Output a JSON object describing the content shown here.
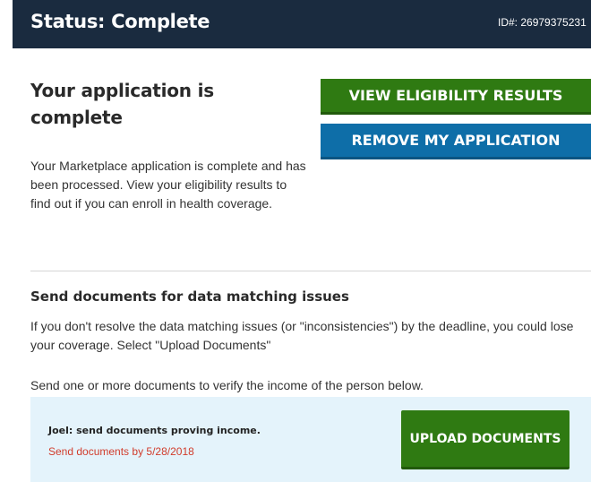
{
  "status_bar": {
    "title": "Status: Complete",
    "id_text": "ID#: 26979375231"
  },
  "application": {
    "heading": "Your application is complete",
    "description": "Your Marketplace application is complete and has been processed. View your eligibility results to find out if you can enroll in health coverage.",
    "view_results_label": "VIEW ELIGIBILITY RESULTS",
    "remove_label": "REMOVE MY APPLICATION"
  },
  "documents": {
    "heading": "Send documents for data matching issues",
    "description": "If you don't resolve the data matching issues (or \"inconsistencies\") by the deadline, you could lose your coverage. Select \"Upload Documents\"",
    "instruction": "Send one or more documents to verify the income of the person below.",
    "task": {
      "title": "Joel: send documents proving income.",
      "deadline": "Send documents by 5/28/2018",
      "upload_label": "UPLOAD DOCUMENTS"
    }
  },
  "colors": {
    "status_bar_bg": "#1a2b3f",
    "green_button": "#2f7a12",
    "blue_button": "#0e6ea8",
    "task_box_bg": "#e4f3fb",
    "deadline_red": "#d13c2c"
  }
}
